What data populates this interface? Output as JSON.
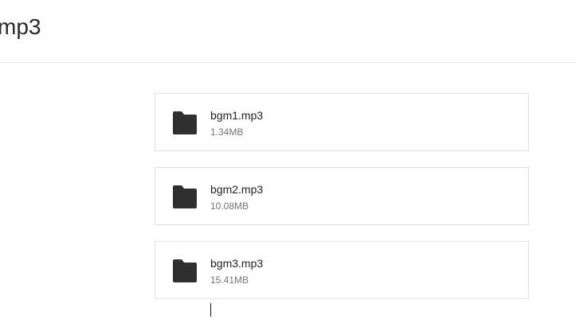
{
  "header": {
    "title": "mp3"
  },
  "files": [
    {
      "name": "bgm1.mp3",
      "size": "1.34MB",
      "icon": "folder-icon"
    },
    {
      "name": "bgm2.mp3",
      "size": "10.08MB",
      "icon": "folder-icon"
    },
    {
      "name": "bgm3.mp3",
      "size": "15.41MB",
      "icon": "folder-icon"
    }
  ],
  "colors": {
    "icon": "#2f2f2f",
    "card_border": "#e0e0e0",
    "title_text": "#2a2a2a",
    "secondary_text": "#777777"
  }
}
